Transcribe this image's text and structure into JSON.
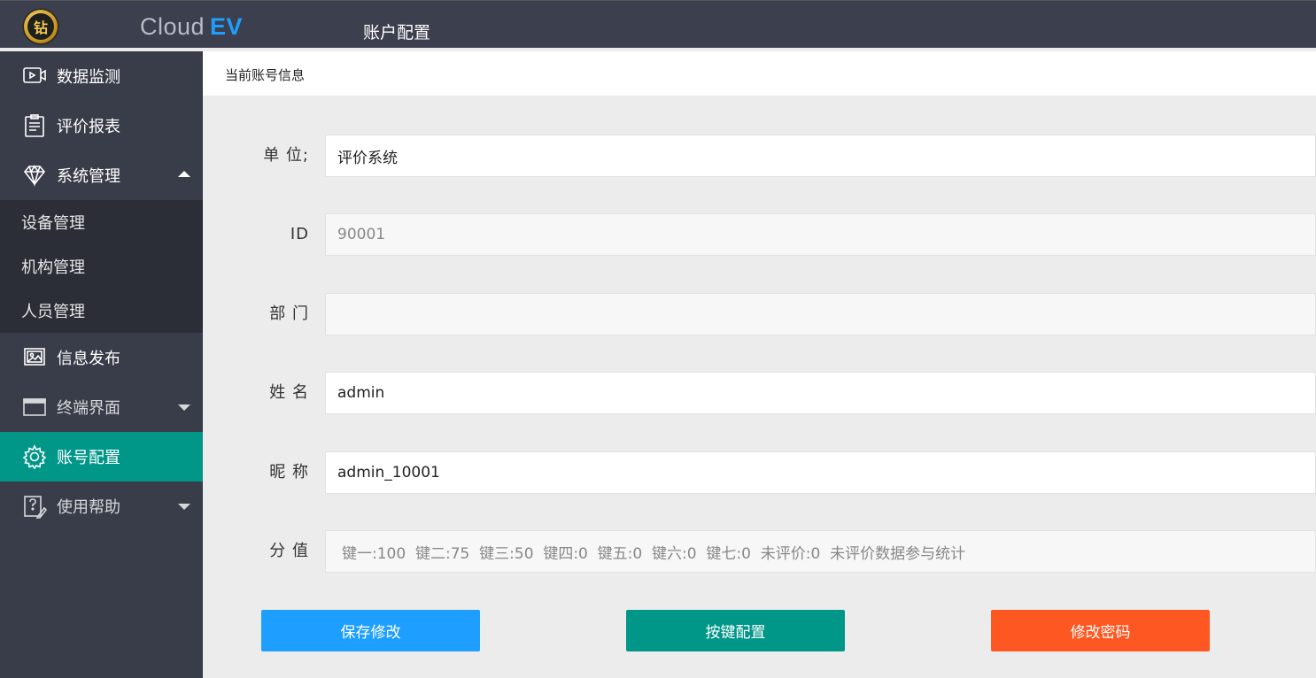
{
  "header": {
    "brand_text": "Cloud",
    "brand_accent": "EV",
    "page_title": "账户配置",
    "logo_glyph": "钻"
  },
  "sidebar": {
    "items": [
      {
        "label": "数据监测",
        "icon": "video-monitor-icon"
      },
      {
        "label": "评价报表",
        "icon": "clipboard-icon"
      },
      {
        "label": "系统管理",
        "icon": "diamond-icon",
        "expanded": true
      },
      {
        "label": "信息发布",
        "icon": "picture-icon"
      },
      {
        "label": "终端界面",
        "icon": "window-icon",
        "expanded": false
      },
      {
        "label": "账号配置",
        "icon": "gear-icon",
        "active": true
      },
      {
        "label": "使用帮助",
        "icon": "help-edit-icon",
        "expanded": false
      }
    ],
    "submenu": [
      {
        "label": "设备管理"
      },
      {
        "label": "机构管理"
      },
      {
        "label": "人员管理"
      }
    ]
  },
  "main": {
    "section_title": "当前账号信息",
    "form": {
      "unit": {
        "label": "单 位;",
        "value": "评价系统"
      },
      "id": {
        "label": "ID",
        "value": "90001"
      },
      "department": {
        "label": "部 门",
        "value": ""
      },
      "name": {
        "label": "姓 名",
        "value": "admin"
      },
      "nickname": {
        "label": "昵 称",
        "value": "admin_10001"
      },
      "score": {
        "label": "分 值",
        "value": "键一:100  键二:75  键三:50  键四:0  键五:0  键六:0  键七:0  未评价:0  未评价数据参与统计"
      }
    },
    "buttons": {
      "save": "保存修改",
      "keys": "按键配置",
      "password": "修改密码"
    }
  },
  "colors": {
    "topbar": "#3b3f4e",
    "sidebar": "#393d49",
    "active": "#009688",
    "accent_blue": "#1e9fff",
    "accent_orange": "#ff5722"
  }
}
